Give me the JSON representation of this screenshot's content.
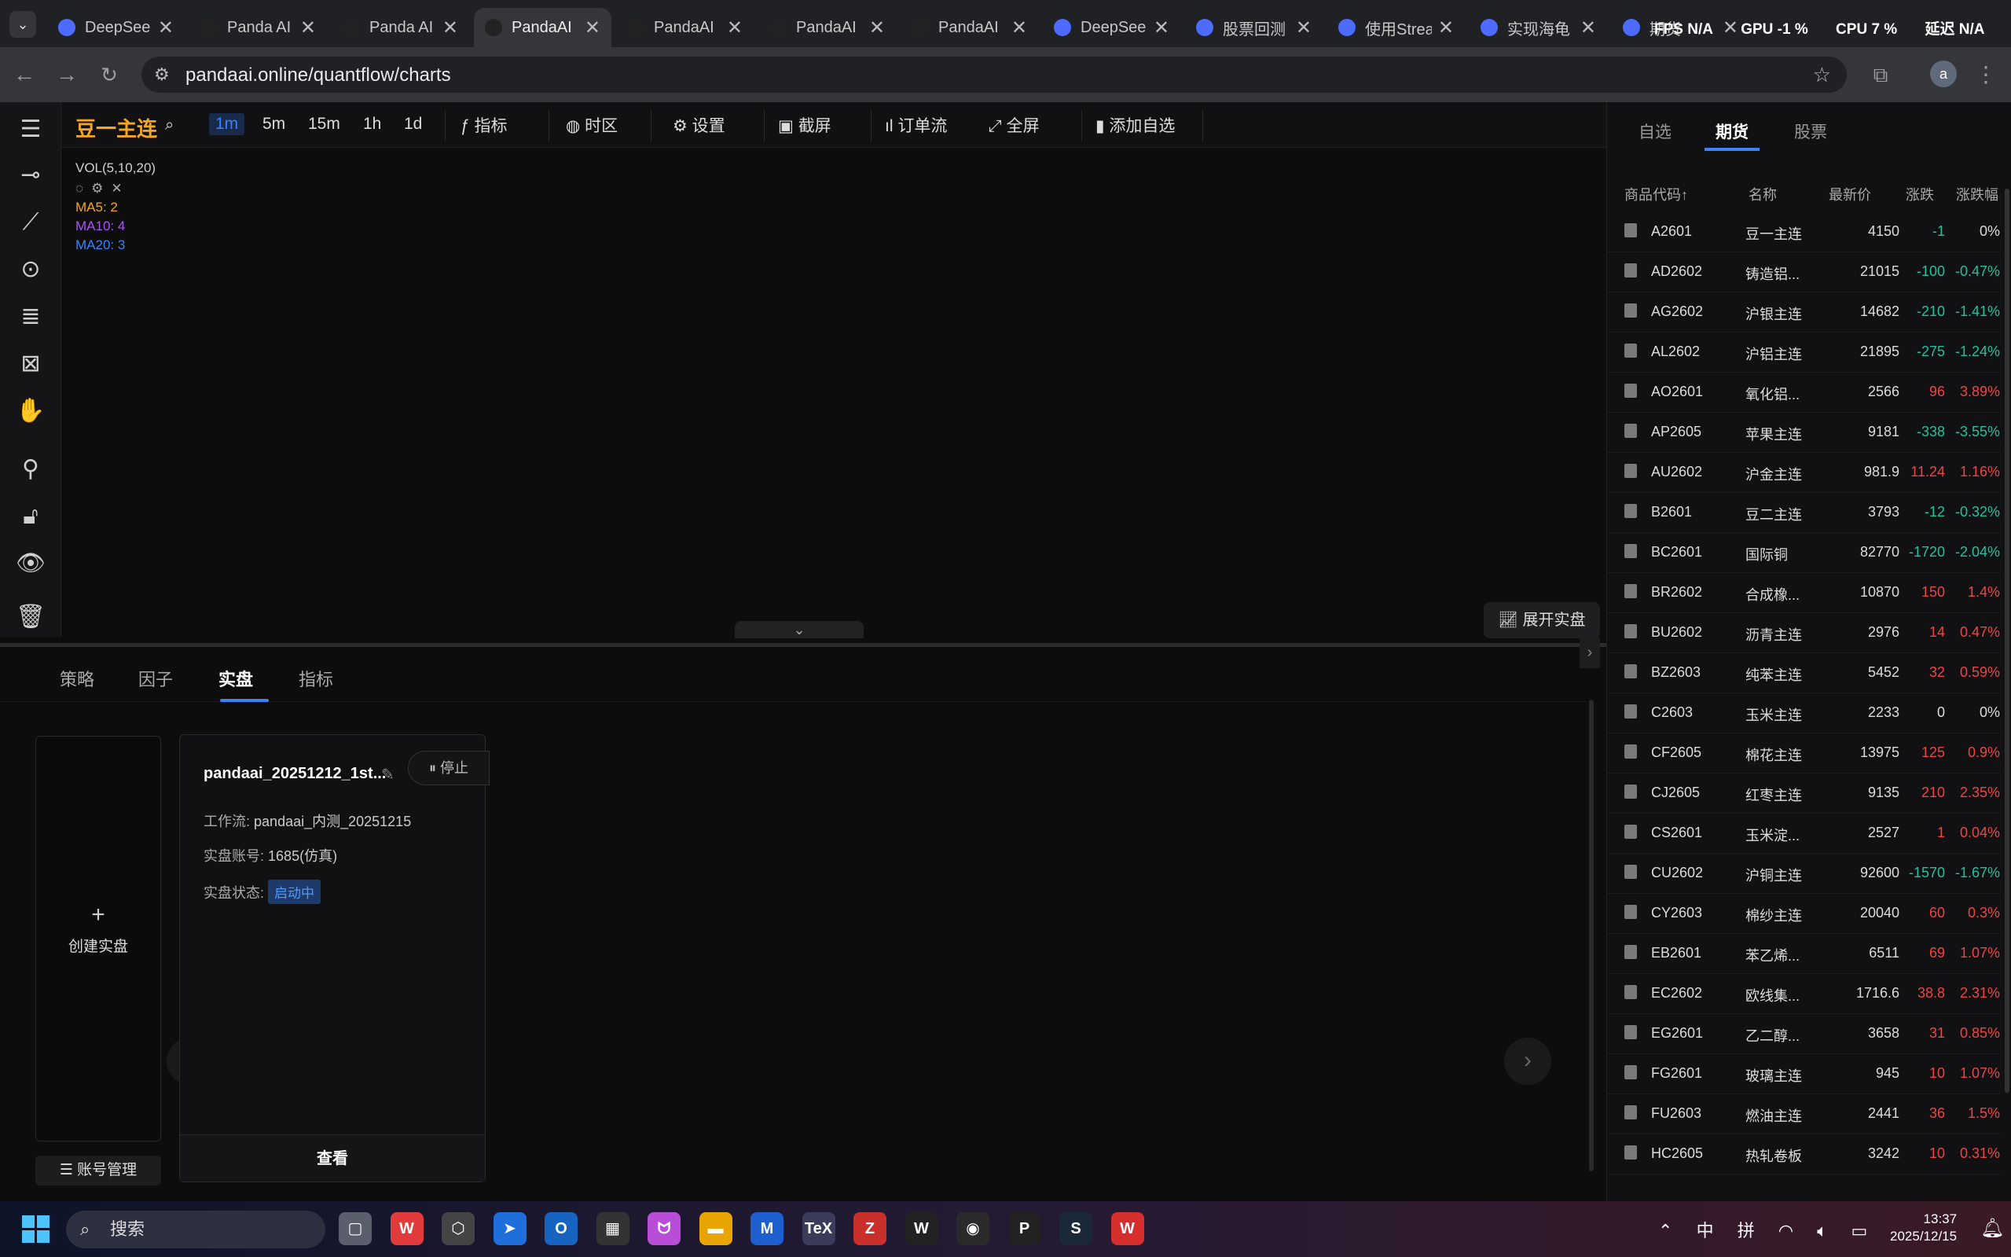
{
  "browser": {
    "tabs": [
      {
        "title": "DeepSee",
        "color": "#4d6bfe"
      },
      {
        "title": "Panda AI",
        "color": "#222"
      },
      {
        "title": "Panda AI",
        "color": "#222"
      },
      {
        "title": "PandaAI",
        "color": "#222",
        "active": true
      },
      {
        "title": "PandaAI",
        "color": "#222"
      },
      {
        "title": "PandaAI",
        "color": "#222"
      },
      {
        "title": "PandaAI",
        "color": "#222"
      },
      {
        "title": "DeepSee",
        "color": "#4d6bfe"
      },
      {
        "title": "股票回测",
        "color": "#4d6bfe"
      },
      {
        "title": "使用Strea",
        "color": "#4d6bfe"
      },
      {
        "title": "实现海龟",
        "color": "#4d6bfe"
      },
      {
        "title": "期货",
        "color": "#4d6bfe"
      }
    ],
    "close_glyph": "✕",
    "hud": {
      "fps": "FPS N/A",
      "gpu": "GPU -1 %",
      "cpu": "CPU 7 %",
      "latency": "延迟 N/A"
    },
    "url": "pandaai.online/quantflow/charts",
    "profile_initial": "a"
  },
  "topbar": {
    "symbol": "豆一主连",
    "timeframes": [
      "1m",
      "5m",
      "15m",
      "1h",
      "1d"
    ],
    "active_timeframe": "1m",
    "buttons": {
      "indicators": "指标",
      "timezone": "时区",
      "settings": "设置",
      "screenshot": "截屏",
      "orderflow": "订单流",
      "fullscreen": "全屏",
      "add_watch": "添加自选"
    }
  },
  "indicator_panel": {
    "title": "VOL(5,10,20)",
    "ma5": "MA5: 2",
    "ma10": "MA10: 4",
    "ma20": "MA20: 3",
    "colors": {
      "ma5": "#f5a623",
      "ma10": "#a855f7",
      "ma20": "#3b82f6"
    }
  },
  "expand_live": "展开实盘",
  "bottom": {
    "tabs": [
      "策略",
      "因子",
      "实盘",
      "指标"
    ],
    "active_tab": "实盘",
    "create_label": "创建实盘",
    "account_btn": "账号管理",
    "live_card": {
      "name": "pandaai_20251212_1st...",
      "stop": "停止",
      "workflow_label": "工作流:",
      "workflow_value": "pandaai_内测_20251215",
      "account_label": "实盘账号:",
      "account_value": "1685(仿真)",
      "status_label": "实盘状态:",
      "status_value": "启动中",
      "view": "查看"
    }
  },
  "watchlist": {
    "tabs": [
      "自选",
      "期货",
      "股票"
    ],
    "active_tab": "期货",
    "headers": [
      "商品代码↑",
      "名称",
      "最新价",
      "涨跌",
      "涨跌幅"
    ],
    "rows": [
      {
        "code": "A2601",
        "name": "豆一主连",
        "price": "4150",
        "chg": "-1",
        "pct": "0%",
        "dir": "down",
        "pctdir": "flat"
      },
      {
        "code": "AD2602",
        "name": "铸造铝...",
        "price": "21015",
        "chg": "-100",
        "pct": "-0.47%",
        "dir": "down",
        "pctdir": "down"
      },
      {
        "code": "AG2602",
        "name": "沪银主连",
        "price": "14682",
        "chg": "-210",
        "pct": "-1.41%",
        "dir": "down",
        "pctdir": "down"
      },
      {
        "code": "AL2602",
        "name": "沪铝主连",
        "price": "21895",
        "chg": "-275",
        "pct": "-1.24%",
        "dir": "down",
        "pctdir": "down"
      },
      {
        "code": "AO2601",
        "name": "氧化铝...",
        "price": "2566",
        "chg": "96",
        "pct": "3.89%",
        "dir": "up",
        "pctdir": "up"
      },
      {
        "code": "AP2605",
        "name": "苹果主连",
        "price": "9181",
        "chg": "-338",
        "pct": "-3.55%",
        "dir": "down",
        "pctdir": "down"
      },
      {
        "code": "AU2602",
        "name": "沪金主连",
        "price": "981.9",
        "chg": "11.24",
        "pct": "1.16%",
        "dir": "up",
        "pctdir": "up"
      },
      {
        "code": "B2601",
        "name": "豆二主连",
        "price": "3793",
        "chg": "-12",
        "pct": "-0.32%",
        "dir": "down",
        "pctdir": "down"
      },
      {
        "code": "BC2601",
        "name": "国际铜",
        "price": "82770",
        "chg": "-1720",
        "pct": "-2.04%",
        "dir": "down",
        "pctdir": "down"
      },
      {
        "code": "BR2602",
        "name": "合成橡...",
        "price": "10870",
        "chg": "150",
        "pct": "1.4%",
        "dir": "up",
        "pctdir": "up"
      },
      {
        "code": "BU2602",
        "name": "沥青主连",
        "price": "2976",
        "chg": "14",
        "pct": "0.47%",
        "dir": "up",
        "pctdir": "up"
      },
      {
        "code": "BZ2603",
        "name": "纯苯主连",
        "price": "5452",
        "chg": "32",
        "pct": "0.59%",
        "dir": "up",
        "pctdir": "up"
      },
      {
        "code": "C2603",
        "name": "玉米主连",
        "price": "2233",
        "chg": "0",
        "pct": "0%",
        "dir": "flat",
        "pctdir": "flat"
      },
      {
        "code": "CF2605",
        "name": "棉花主连",
        "price": "13975",
        "chg": "125",
        "pct": "0.9%",
        "dir": "up",
        "pctdir": "up"
      },
      {
        "code": "CJ2605",
        "name": "红枣主连",
        "price": "9135",
        "chg": "210",
        "pct": "2.35%",
        "dir": "up",
        "pctdir": "up"
      },
      {
        "code": "CS2601",
        "name": "玉米淀...",
        "price": "2527",
        "chg": "1",
        "pct": "0.04%",
        "dir": "up",
        "pctdir": "up"
      },
      {
        "code": "CU2602",
        "name": "沪铜主连",
        "price": "92600",
        "chg": "-1570",
        "pct": "-1.67%",
        "dir": "down",
        "pctdir": "down"
      },
      {
        "code": "CY2603",
        "name": "棉纱主连",
        "price": "20040",
        "chg": "60",
        "pct": "0.3%",
        "dir": "up",
        "pctdir": "up"
      },
      {
        "code": "EB2601",
        "name": "苯乙烯...",
        "price": "6511",
        "chg": "69",
        "pct": "1.07%",
        "dir": "up",
        "pctdir": "up"
      },
      {
        "code": "EC2602",
        "name": "欧线集...",
        "price": "1716.6",
        "chg": "38.8",
        "pct": "2.31%",
        "dir": "up",
        "pctdir": "up"
      },
      {
        "code": "EG2601",
        "name": "乙二醇...",
        "price": "3658",
        "chg": "31",
        "pct": "0.85%",
        "dir": "up",
        "pctdir": "up"
      },
      {
        "code": "FG2601",
        "name": "玻璃主连",
        "price": "945",
        "chg": "10",
        "pct": "1.07%",
        "dir": "up",
        "pctdir": "up"
      },
      {
        "code": "FU2603",
        "name": "燃油主连",
        "price": "2441",
        "chg": "36",
        "pct": "1.5%",
        "dir": "up",
        "pctdir": "up"
      },
      {
        "code": "HC2605",
        "name": "热轧卷板",
        "price": "3242",
        "chg": "10",
        "pct": "0.31%",
        "dir": "up",
        "pctdir": "up"
      }
    ]
  },
  "taskbar": {
    "search": "搜索",
    "apps": [
      {
        "name": "file-stack",
        "label": "▢",
        "color": "#5a5f6b"
      },
      {
        "name": "wps-office",
        "label": "W",
        "color": "#e23b3b"
      },
      {
        "name": "box-app",
        "label": "⬡",
        "color": "#444"
      },
      {
        "name": "feather-app",
        "label": "➤",
        "color": "#1e6fd9"
      },
      {
        "name": "outlook",
        "label": "O",
        "color": "#1764c0"
      },
      {
        "name": "tiles-app",
        "label": "▦",
        "color": "#333"
      },
      {
        "name": "cat-app",
        "label": "ᗢ",
        "color": "#b84dd8"
      },
      {
        "name": "explorer",
        "label": "▬",
        "color": "#e8a400"
      },
      {
        "name": "mq-app",
        "label": "M",
        "color": "#1e5fd0"
      },
      {
        "name": "tex-app",
        "label": "TeX",
        "color": "#3b3b5a"
      },
      {
        "name": "z-app",
        "label": "Z",
        "color": "#c9302c"
      },
      {
        "name": "wps-dark",
        "label": "W",
        "color": "#222"
      },
      {
        "name": "chrome",
        "label": "◉",
        "color": "#2a2a2a"
      },
      {
        "name": "panda-app",
        "label": "P",
        "color": "#222"
      },
      {
        "name": "steam",
        "label": "S",
        "color": "#1b2838"
      },
      {
        "name": "wps-red",
        "label": "W",
        "color": "#d62d2d"
      }
    ],
    "tray": {
      "ime1": "中",
      "ime2": "拼"
    },
    "time": "13:37",
    "date": "2025/12/15"
  }
}
